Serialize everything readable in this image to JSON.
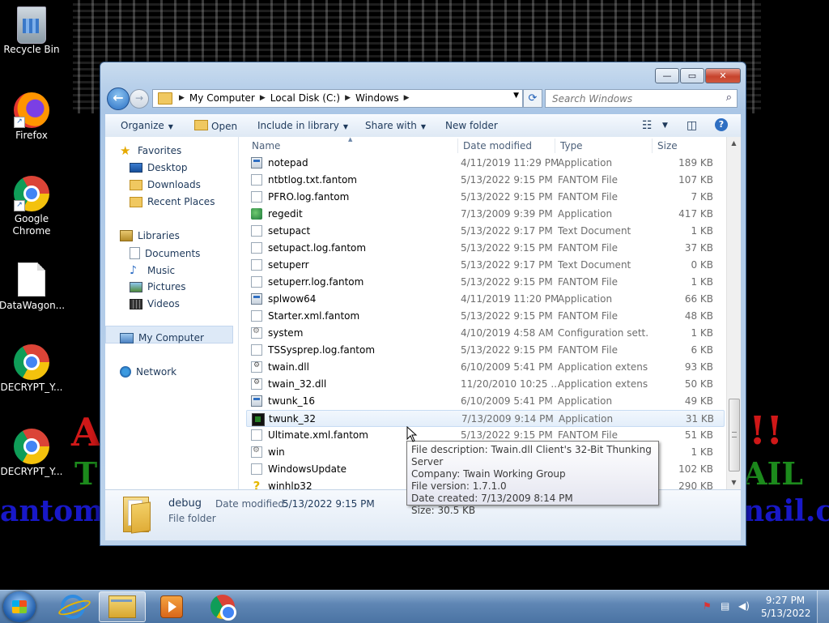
{
  "wallpaper": {
    "line1_left": "A",
    "line1_right": "!!",
    "line2_left": "T",
    "line2_right": "AIL",
    "line3_left": "antom",
    "line3_right": "nail.c"
  },
  "desktop_icons": [
    {
      "label": "Recycle Bin"
    },
    {
      "label": "Firefox"
    },
    {
      "label": "Google Chrome"
    },
    {
      "label": "DataWagon..."
    },
    {
      "label": "DECRYPT_Y..."
    },
    {
      "label": "DECRYPT_Y..."
    }
  ],
  "window": {
    "controls": {
      "minimize": "—",
      "maximize": "▭",
      "close": "✕"
    },
    "address": {
      "crumbs": [
        "My Computer",
        "Local Disk (C:)",
        "Windows"
      ]
    },
    "search": {
      "placeholder": "Search Windows"
    },
    "toolbar": {
      "organize": "Organize",
      "open": "Open",
      "include": "Include in library",
      "share": "Share with",
      "newfolder": "New folder"
    },
    "navpane": {
      "favorites": "Favorites",
      "desktop": "Desktop",
      "downloads": "Downloads",
      "recent": "Recent Places",
      "libraries": "Libraries",
      "documents": "Documents",
      "music": "Music",
      "pictures": "Pictures",
      "videos": "Videos",
      "mycomputer": "My Computer",
      "network": "Network"
    },
    "columns": {
      "name": "Name",
      "date": "Date modified",
      "type": "Type",
      "size": "Size"
    },
    "files": [
      {
        "name": "notepad",
        "date": "4/11/2019 11:29 PM",
        "type": "Application",
        "size": "189 KB",
        "icon": "app-icon"
      },
      {
        "name": "ntbtlog.txt.fantom",
        "date": "5/13/2022 9:15 PM",
        "type": "FANTOM File",
        "size": "107 KB",
        "icon": "file-icon"
      },
      {
        "name": "PFRO.log.fantom",
        "date": "5/13/2022 9:15 PM",
        "type": "FANTOM File",
        "size": "7 KB",
        "icon": "file-icon"
      },
      {
        "name": "regedit",
        "date": "7/13/2009 9:39 PM",
        "type": "Application",
        "size": "417 KB",
        "icon": "regedit-icon"
      },
      {
        "name": "setupact",
        "date": "5/13/2022 9:17 PM",
        "type": "Text Document",
        "size": "1 KB",
        "icon": "text-icon"
      },
      {
        "name": "setupact.log.fantom",
        "date": "5/13/2022 9:15 PM",
        "type": "FANTOM File",
        "size": "37 KB",
        "icon": "file-icon"
      },
      {
        "name": "setuperr",
        "date": "5/13/2022 9:17 PM",
        "type": "Text Document",
        "size": "0 KB",
        "icon": "text-icon"
      },
      {
        "name": "setuperr.log.fantom",
        "date": "5/13/2022 9:15 PM",
        "type": "FANTOM File",
        "size": "1 KB",
        "icon": "file-icon"
      },
      {
        "name": "splwow64",
        "date": "4/11/2019 11:20 PM",
        "type": "Application",
        "size": "66 KB",
        "icon": "app-icon"
      },
      {
        "name": "Starter.xml.fantom",
        "date": "5/13/2022 9:15 PM",
        "type": "FANTOM File",
        "size": "48 KB",
        "icon": "file-icon"
      },
      {
        "name": "system",
        "date": "4/10/2019 4:58 AM",
        "type": "Configuration sett...",
        "size": "1 KB",
        "icon": "config-icon"
      },
      {
        "name": "TSSysprep.log.fantom",
        "date": "5/13/2022 9:15 PM",
        "type": "FANTOM File",
        "size": "6 KB",
        "icon": "file-icon"
      },
      {
        "name": "twain.dll",
        "date": "6/10/2009 5:41 PM",
        "type": "Application extens...",
        "size": "93 KB",
        "icon": "dll-icon"
      },
      {
        "name": "twain_32.dll",
        "date": "11/20/2010 10:25 ...",
        "type": "Application extens...",
        "size": "50 KB",
        "icon": "dll-icon"
      },
      {
        "name": "twunk_16",
        "date": "6/10/2009 5:41 PM",
        "type": "Application",
        "size": "49 KB",
        "icon": "app-icon"
      },
      {
        "name": "twunk_32",
        "date": "7/13/2009 9:14 PM",
        "type": "Application",
        "size": "31 KB",
        "icon": "twunk-icon"
      },
      {
        "name": "Ultimate.xml.fantom",
        "date": "5/13/2022 9:15 PM",
        "type": "FANTOM File",
        "size": "51 KB",
        "icon": "file-icon"
      },
      {
        "name": "win",
        "date": "",
        "type": "",
        "size": "1 KB",
        "icon": "config-icon"
      },
      {
        "name": "WindowsUpdate",
        "date": "",
        "type": "",
        "size": "102 KB",
        "icon": "text-icon"
      },
      {
        "name": "winhlp32",
        "date": "",
        "type": "",
        "size": "290 KB",
        "icon": "help-icon"
      }
    ],
    "details": {
      "name": "debug",
      "type": "File folder",
      "modified_label": "Date modified:",
      "modified_value": "5/13/2022 9:15 PM"
    },
    "tooltip": {
      "line1": "File description: Twain.dll Client's 32-Bit Thunking Server",
      "line2": "Company: Twain Working Group",
      "line3": "File version: 1.7.1.0",
      "line4": "Date created: 7/13/2009 8:14 PM",
      "line5": "Size: 30.5 KB"
    }
  },
  "taskbar": {
    "clock_time": "9:27 PM",
    "clock_date": "5/13/2022"
  }
}
